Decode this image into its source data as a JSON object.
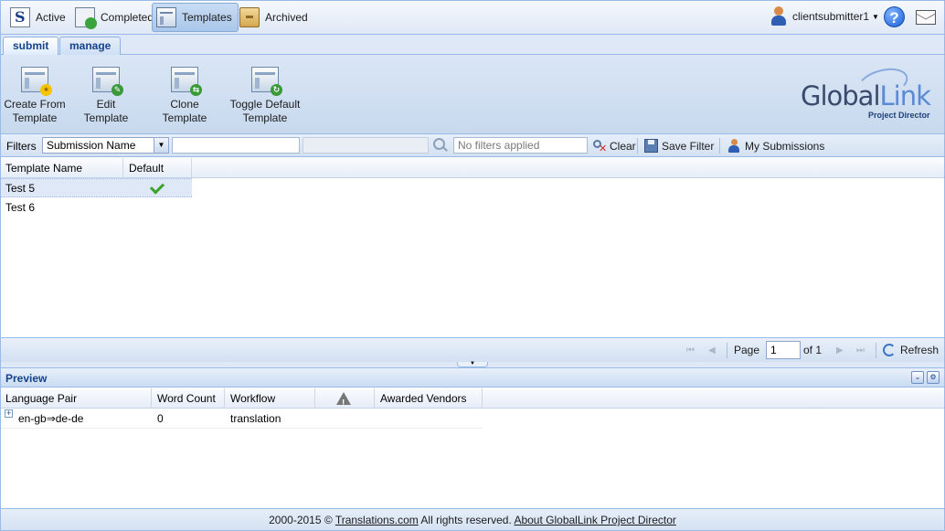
{
  "nav": {
    "items": [
      {
        "label": "Active",
        "icon": "active-icon"
      },
      {
        "label": "Completed",
        "icon": "completed-icon"
      },
      {
        "label": "Templates",
        "icon": "templates-icon",
        "active": true
      },
      {
        "label": "Archived",
        "icon": "archived-icon"
      }
    ],
    "user": "clientsubmitter1",
    "help_glyph": "?"
  },
  "tabs": [
    {
      "label": "submit",
      "active": true
    },
    {
      "label": "manage",
      "active": false
    }
  ],
  "toolbar": {
    "buttons": [
      {
        "label_line1": "Create From",
        "label_line2": "Template"
      },
      {
        "label_line1": "Edit Template",
        "label_line2": ""
      },
      {
        "label_line1": "Clone Template",
        "label_line2": ""
      },
      {
        "label_line1": "Toggle Default",
        "label_line2": "Template"
      }
    ],
    "logo": {
      "word1": "Global",
      "word2": "Link",
      "sub": "Project Director"
    }
  },
  "filters": {
    "label": "Filters",
    "field_selected": "Submission Name",
    "search_value": "",
    "status_placeholder": "No filters applied",
    "clear_label": "Clear",
    "save_label": "Save Filter",
    "my_submissions_label": "My Submissions"
  },
  "grid": {
    "columns": [
      "Template Name",
      "Default"
    ],
    "rows": [
      {
        "name": "Test 5",
        "default": true
      },
      {
        "name": "Test 6",
        "default": false
      }
    ]
  },
  "pager": {
    "page_label": "Page",
    "page_value": "1",
    "of_label": "of 1",
    "refresh_label": "Refresh"
  },
  "preview": {
    "title": "Preview",
    "columns": [
      "Language Pair",
      "Word Count",
      "Workflow",
      "",
      "Awarded Vendors"
    ],
    "rows": [
      {
        "language_pair": "en-gb⇒de-de",
        "word_count": "0",
        "workflow": "translation",
        "awarded_vendors": ""
      }
    ]
  },
  "footer": {
    "prefix": "2000-2015 © ",
    "company_link": "Translations.com",
    "middle": " All rights reserved. ",
    "about_link": "About GlobalLink Project Director"
  },
  "colors": {
    "accent": "#15428b",
    "border": "#99bbe8",
    "selected_row": "#dfe8f6",
    "check_green": "#3da22e"
  }
}
